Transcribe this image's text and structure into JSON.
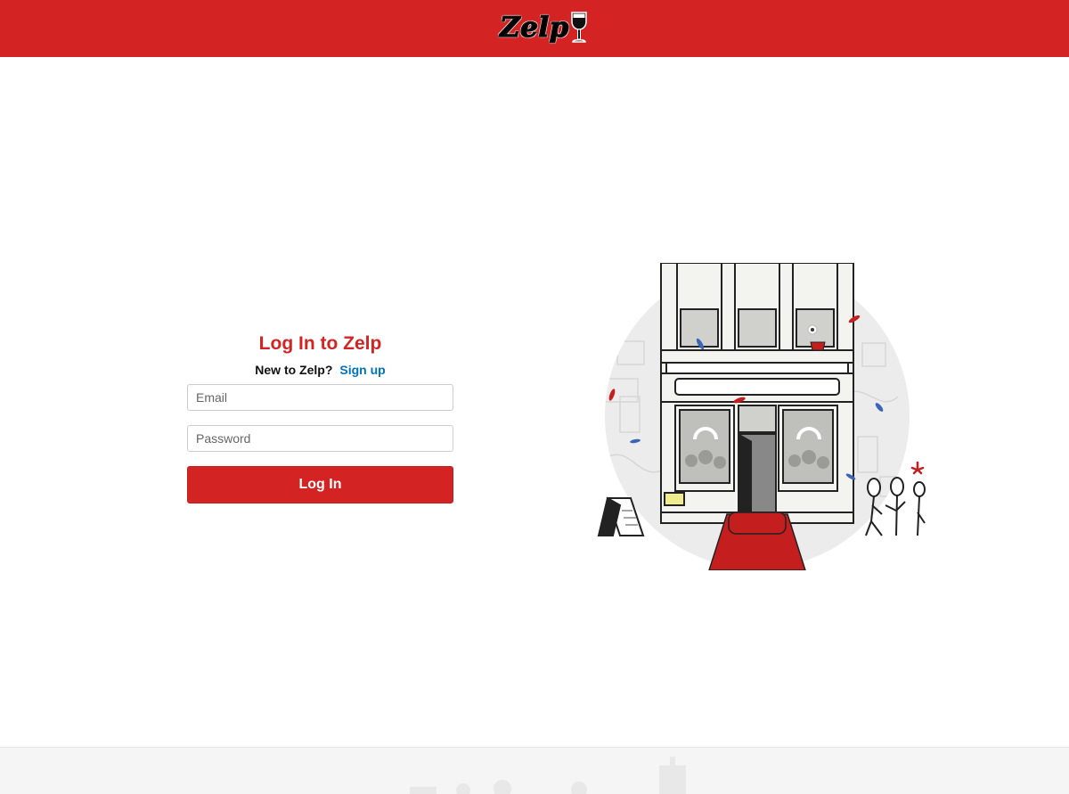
{
  "header": {
    "logo_text": "Zelp",
    "logo_icon": "wine-glass-icon",
    "background": "#d32323"
  },
  "login": {
    "title": "Log In to Zelp",
    "new_prompt": "New to Zelp?",
    "signup_link": "Sign up",
    "email_placeholder": "Email",
    "password_placeholder": "Password",
    "submit_label": "Log In"
  },
  "illustration": {
    "name": "storefront-illustration"
  },
  "colors": {
    "brand_red": "#d32323",
    "link_blue": "#0073bb",
    "footer_bg": "#f5f5f5"
  }
}
